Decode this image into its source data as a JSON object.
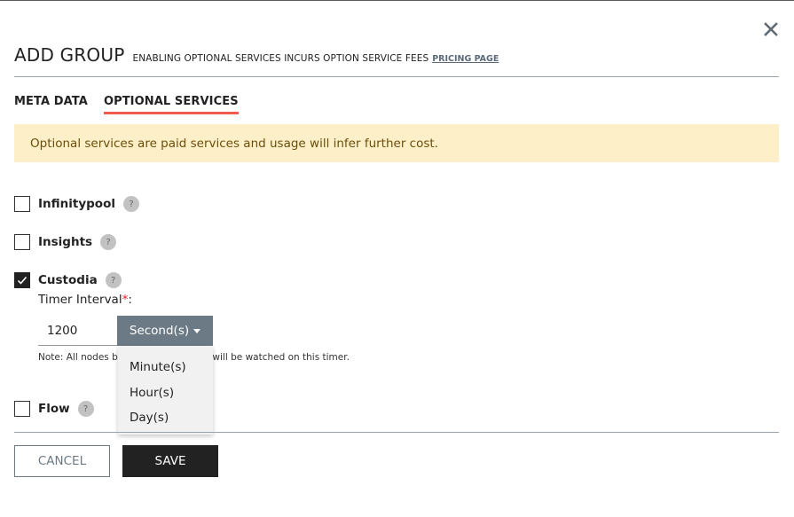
{
  "dialog": {
    "title": "ADD GROUP",
    "subtitle": "ENABLING OPTIONAL SERVICES INCURS OPTION SERVICE FEES",
    "pricing_link": "PRICING PAGE",
    "close_icon": "close-icon"
  },
  "tabs": [
    {
      "label": "META DATA",
      "active": false
    },
    {
      "label": "OPTIONAL SERVICES",
      "active": true
    }
  ],
  "alert": {
    "text": "Optional services are paid services and usage will infer further cost.",
    "background": "#fdf0c8",
    "color": "#6b4e0b"
  },
  "services": [
    {
      "label": "Infinitypool",
      "checked": false,
      "help": "?"
    },
    {
      "label": "Insights",
      "checked": false,
      "help": "?"
    },
    {
      "label": "Custodia",
      "checked": true,
      "help": "?"
    },
    {
      "label": "Flow",
      "checked": false,
      "help": "?"
    }
  ],
  "timer": {
    "label": "Timer Interval",
    "required_mark": "*",
    "suffix": ":",
    "value": "1200",
    "unit_selected": "Second(s)",
    "unit_options": [
      "Minute(s)",
      "Hour(s)",
      "Day(s)"
    ],
    "note": "Note: All nodes b",
    "note_tail": "up will be watched on this timer."
  },
  "footer": {
    "cancel_label": "CANCEL",
    "save_label": "SAVE"
  },
  "colors": {
    "accent_underline": "#f05a4f",
    "button_slate": "#6c7a85",
    "save_bg": "#222222"
  }
}
